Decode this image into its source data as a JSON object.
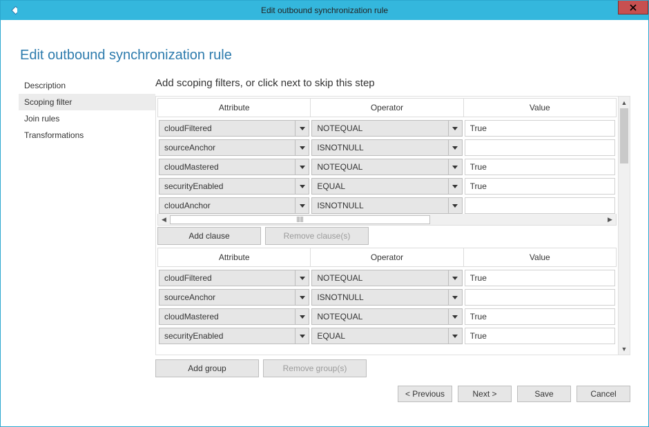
{
  "window": {
    "title": "Edit outbound synchronization rule"
  },
  "heading": "Edit outbound synchronization rule",
  "sidebar": {
    "items": [
      {
        "label": "Description",
        "selected": false
      },
      {
        "label": "Scoping filter",
        "selected": true
      },
      {
        "label": "Join rules",
        "selected": false
      },
      {
        "label": "Transformations",
        "selected": false
      }
    ]
  },
  "main": {
    "instruction": "Add scoping filters, or click next to skip this step",
    "columns": {
      "attribute": "Attribute",
      "operator": "Operator",
      "value": "Value"
    },
    "groups": [
      {
        "rows": [
          {
            "attribute": "cloudFiltered",
            "operator": "NOTEQUAL",
            "value": "True"
          },
          {
            "attribute": "sourceAnchor",
            "operator": "ISNOTNULL",
            "value": ""
          },
          {
            "attribute": "cloudMastered",
            "operator": "NOTEQUAL",
            "value": "True"
          },
          {
            "attribute": "securityEnabled",
            "operator": "EQUAL",
            "value": "True"
          },
          {
            "attribute": "cloudAnchor",
            "operator": "ISNOTNULL",
            "value": ""
          }
        ],
        "show_hscroll": true,
        "buttons": {
          "add": "Add clause",
          "remove": "Remove clause(s)"
        }
      },
      {
        "rows": [
          {
            "attribute": "cloudFiltered",
            "operator": "NOTEQUAL",
            "value": "True"
          },
          {
            "attribute": "sourceAnchor",
            "operator": "ISNOTNULL",
            "value": ""
          },
          {
            "attribute": "cloudMastered",
            "operator": "NOTEQUAL",
            "value": "True"
          },
          {
            "attribute": "securityEnabled",
            "operator": "EQUAL",
            "value": "True"
          }
        ],
        "show_hscroll": false,
        "buttons": null
      }
    ],
    "group_buttons": {
      "add": "Add group",
      "remove": "Remove group(s)"
    }
  },
  "footer": {
    "previous": "< Previous",
    "next": "Next >",
    "save": "Save",
    "cancel": "Cancel"
  }
}
